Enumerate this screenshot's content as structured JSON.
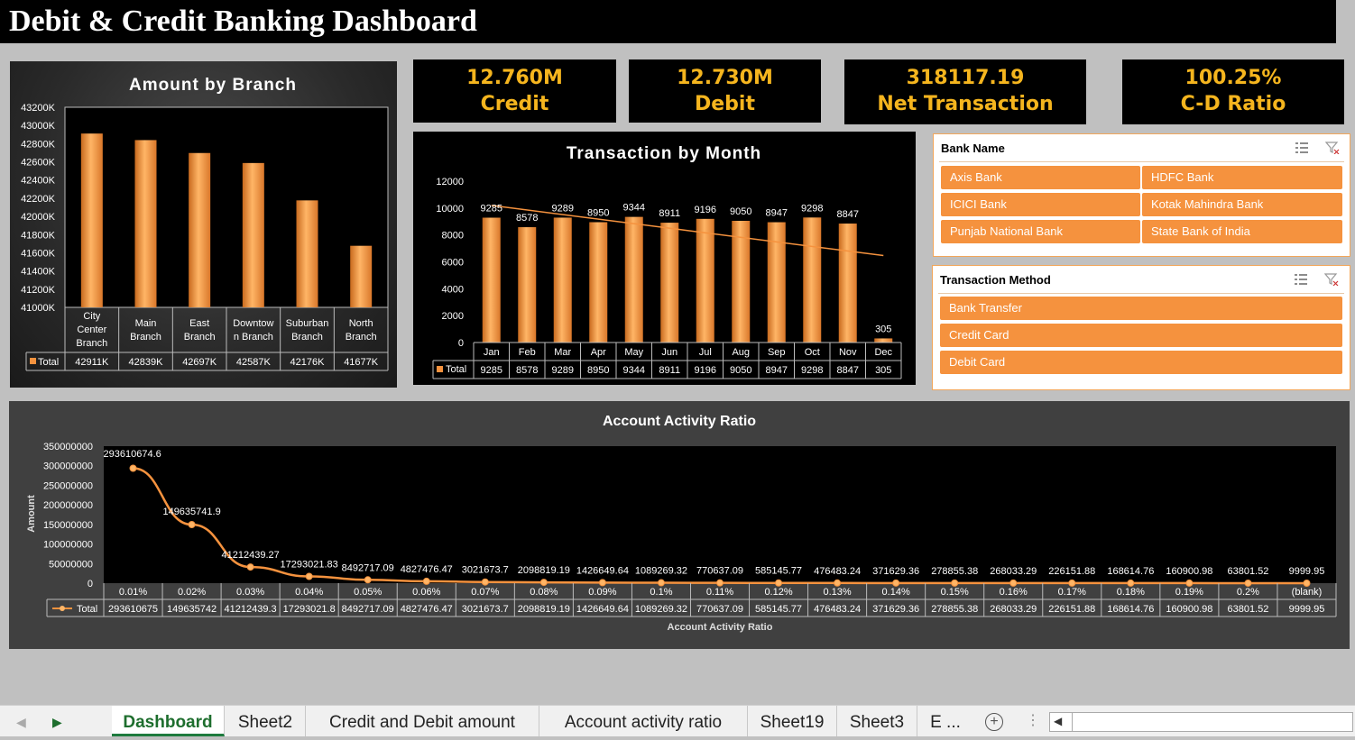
{
  "title": "Debit & Credit Banking Dashboard",
  "kpis": [
    {
      "value": "12.760M",
      "label": "Credit"
    },
    {
      "value": "12.730M",
      "label": "Debit"
    },
    {
      "value": "318117.19",
      "label": "Net Transaction"
    },
    {
      "value": "100.25%",
      "label": "C-D Ratio"
    }
  ],
  "branch_chart": {
    "title": "Amount by Branch",
    "legend_label": "Total",
    "yticks": [
      "43200K",
      "43000K",
      "42800K",
      "42600K",
      "42400K",
      "42200K",
      "42000K",
      "41800K",
      "41600K",
      "41400K",
      "41200K",
      "41000K"
    ],
    "categories": [
      [
        "City",
        "Center",
        "Branch"
      ],
      [
        "Main",
        "Branch"
      ],
      [
        "East",
        "Branch"
      ],
      [
        "Downtow",
        "n Branch"
      ],
      [
        "Suburban",
        "Branch"
      ],
      [
        "North",
        "Branch"
      ]
    ],
    "table_values": [
      "42911K",
      "42839K",
      "42697K",
      "42587K",
      "42176K",
      "41677K"
    ]
  },
  "month_chart": {
    "title": "Transaction by Month",
    "legend_label": "Total",
    "yticks": [
      "12000",
      "10000",
      "8000",
      "6000",
      "4000",
      "2000",
      "0"
    ]
  },
  "activity_chart": {
    "title": "Account Activity Ratio",
    "ylabel": "Amount",
    "xlabel": "Account Activity Ratio",
    "legend_label": "Total",
    "yticks": [
      "350000000",
      "300000000",
      "250000000",
      "200000000",
      "150000000",
      "100000000",
      "50000000",
      "0"
    ],
    "point_labels": [
      "293610674.6",
      "149635741.9",
      "41212439.27",
      "17293021.83",
      "8492717.09",
      "4827476.47",
      "3021673.7",
      "2098819.19",
      "1426649.64",
      "1089269.32",
      "770637.09",
      "585145.77",
      "476483.24",
      "371629.36",
      "278855.38",
      "268033.29",
      "226151.88",
      "168614.76",
      "160900.98",
      "63801.52",
      "9999.95"
    ],
    "table_values": [
      "293610675",
      "149635742",
      "41212439.3",
      "17293021.8",
      "8492717.09",
      "4827476.47",
      "3021673.7",
      "2098819.19",
      "1426649.64",
      "1089269.32",
      "770637.09",
      "585145.77",
      "476483.24",
      "371629.36",
      "278855.38",
      "268033.29",
      "226151.88",
      "168614.76",
      "160900.98",
      "63801.52",
      "9999.95"
    ]
  },
  "chart_data": [
    {
      "type": "bar",
      "title": "Amount by Branch",
      "categories": [
        "City Center Branch",
        "Main Branch",
        "East Branch",
        "Downtown Branch",
        "Suburban Branch",
        "North Branch"
      ],
      "series": [
        {
          "name": "Total",
          "values": [
            42911,
            42839,
            42697,
            42587,
            42176,
            41677
          ]
        }
      ],
      "ylim": [
        41000,
        43200
      ],
      "grid": false,
      "legend": "table"
    },
    {
      "type": "bar",
      "title": "Transaction by Month",
      "categories": [
        "Jan",
        "Feb",
        "Mar",
        "Apr",
        "May",
        "Jun",
        "Jul",
        "Aug",
        "Sep",
        "Oct",
        "Nov",
        "Dec"
      ],
      "series": [
        {
          "name": "Total",
          "values": [
            9285,
            8578,
            9289,
            8950,
            9344,
            8911,
            9196,
            9050,
            8947,
            9298,
            8847,
            305
          ]
        }
      ],
      "trendline": true,
      "ylim": [
        0,
        12000
      ],
      "grid": false,
      "legend": "table"
    },
    {
      "type": "line",
      "title": "Account Activity Ratio",
      "xlabel": "Account Activity Ratio",
      "ylabel": "Amount",
      "categories": [
        "0.01%",
        "0.02%",
        "0.03%",
        "0.04%",
        "0.05%",
        "0.06%",
        "0.07%",
        "0.08%",
        "0.09%",
        "0.1%",
        "0.11%",
        "0.12%",
        "0.13%",
        "0.14%",
        "0.15%",
        "0.16%",
        "0.17%",
        "0.18%",
        "0.19%",
        "0.2%",
        "(blank)"
      ],
      "series": [
        {
          "name": "Total",
          "values": [
            293610674.6,
            149635741.9,
            41212439.27,
            17293021.83,
            8492717.09,
            4827476.47,
            3021673.7,
            2098819.19,
            1426649.64,
            1089269.32,
            770637.09,
            585145.77,
            476483.24,
            371629.36,
            278855.38,
            268033.29,
            226151.88,
            168614.76,
            160900.98,
            63801.52,
            9999.95
          ]
        }
      ],
      "ylim": [
        0,
        350000000
      ],
      "grid": false,
      "legend": "table"
    }
  ],
  "slicers": {
    "bank": {
      "title": "Bank Name",
      "items": [
        "Axis Bank",
        "HDFC Bank",
        "ICICI Bank",
        "Kotak Mahindra Bank",
        "Punjab National Bank",
        "State Bank of India"
      ]
    },
    "method": {
      "title": "Transaction Method",
      "items": [
        "Bank Transfer",
        "Credit Card",
        "Debit Card"
      ]
    }
  },
  "tabs": [
    "Dashboard",
    "Sheet2",
    "Credit and Debit amount",
    "Account activity ratio",
    "Sheet19",
    "Sheet3",
    "E ..."
  ],
  "colors": {
    "bar": "#f5923e",
    "accent_text": "#f5b51e",
    "tab_active": "#1e6e2e"
  }
}
